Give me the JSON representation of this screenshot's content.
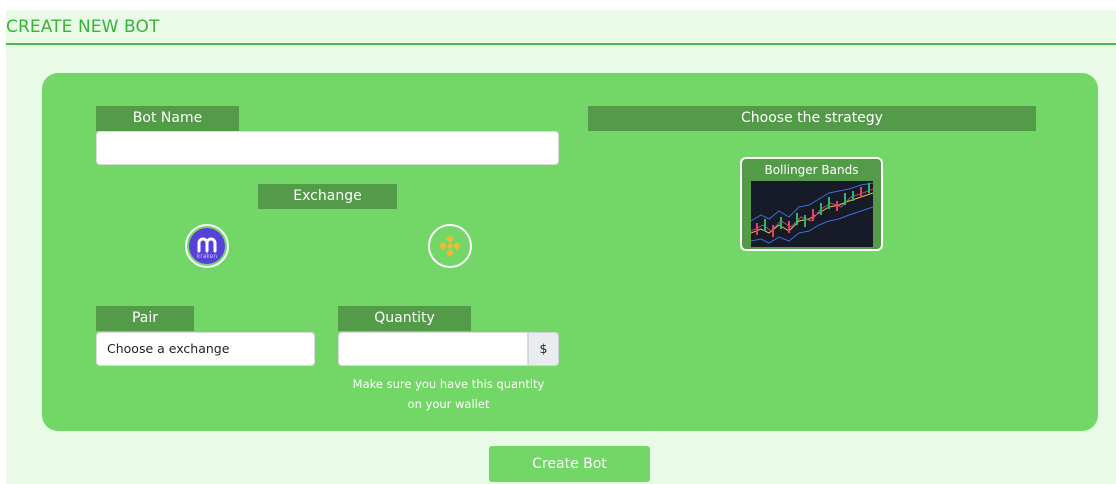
{
  "header": {
    "title": "CREATE NEW BOT"
  },
  "form": {
    "bot_name_label": "Bot Name",
    "bot_name_value": "",
    "exchange_label": "Exchange",
    "exchanges": [
      {
        "name": "kraken",
        "icon": "kraken-logo-icon",
        "text": "kraken"
      },
      {
        "name": "binance",
        "icon": "binance-logo-icon"
      }
    ],
    "pair_label": "Pair",
    "pair_value": "Choose a exchange",
    "quantity_label": "Quantity",
    "quantity_value": "",
    "quantity_unit": "$",
    "quantity_help_line1": "Make sure you have this quantity",
    "quantity_help_line2": "on your wallet"
  },
  "strategy": {
    "label": "Choose the strategy",
    "options": [
      {
        "name": "Bollinger Bands",
        "icon": "bollinger-bands-chart-icon"
      }
    ]
  },
  "actions": {
    "create_label": "Create Bot"
  },
  "colors": {
    "page_bg": "#e9fbe6",
    "panel": "#72d766",
    "tag": "#539b48",
    "title": "#3ab13a",
    "kraken": "#5741d9",
    "binance": "#f3ba2f"
  }
}
